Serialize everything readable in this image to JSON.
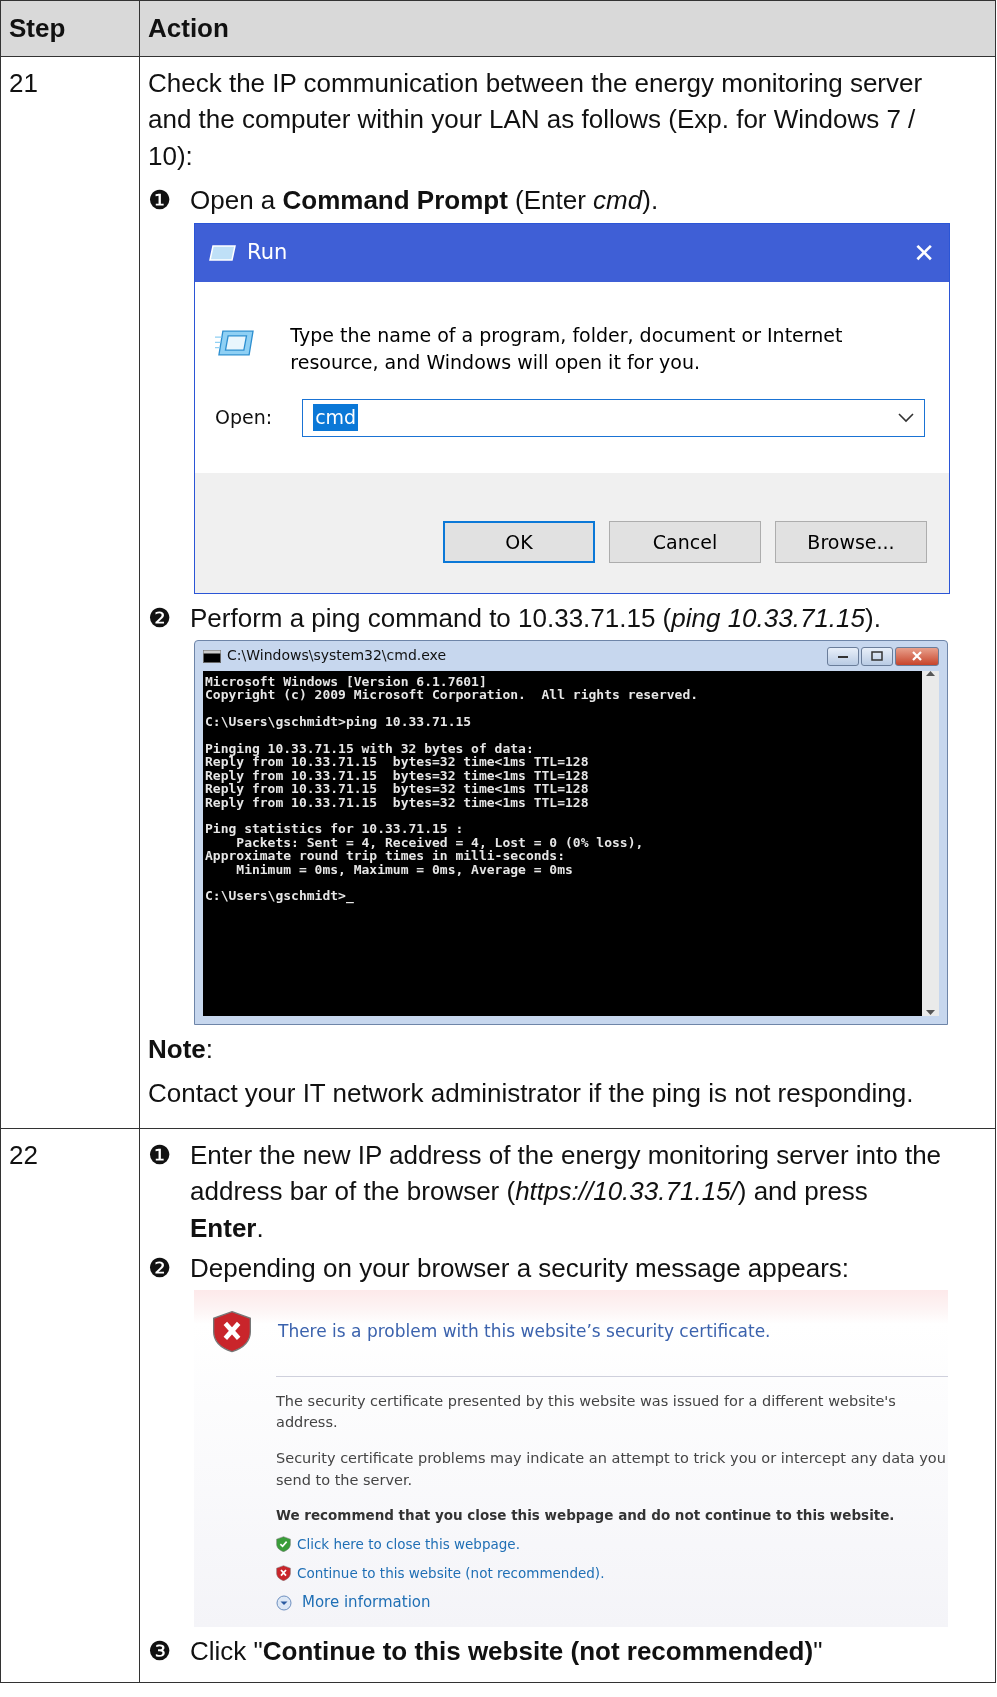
{
  "table": {
    "columns": [
      "Step",
      "Action"
    ],
    "rows": [
      {
        "step": "21",
        "blocks": [
          {
            "kind": "paragraph",
            "text": "Check the IP communication between the energy monitoring server and the computer within your LAN as follows (Exp. for Windows 7 / 10):"
          },
          {
            "kind": "item",
            "marker": "❶",
            "text": "Open a **Command Prompt** (Enter *cmd*)."
          },
          {
            "kind": "run_dialog",
            "title": "Run",
            "close": "✕",
            "message": "Type the name of a program, folder, document or Internet resource, and Windows will open it for you.",
            "field_label": "Open:",
            "value": "cmd",
            "buttons": [
              {
                "label": "OK",
                "selected": true
              },
              {
                "label": "Cancel",
                "selected": false
              },
              {
                "label": "Browse...",
                "selected": false
              }
            ]
          },
          {
            "kind": "item",
            "marker": "❷",
            "text": "Perform a ping command to 10.33.71.15 (*ping 10.33.71.15*)."
          },
          {
            "kind": "cmd_window",
            "title": "C:\\Windows\\system32\\cmd.exe",
            "groups": [
              [
                "Microsoft Windows [Version 6.1.7601]",
                "Copyright (c) 2009 Microsoft Corporation.  All rights reserved."
              ],
              [
                "C:\\Users\\gschmidt>ping 10.33.71.15"
              ],
              [
                "Pinging 10.33.71.15 with 32 bytes of data:",
                "Reply from 10.33.71.15  bytes=32 time<1ms TTL=128",
                "Reply from 10.33.71.15  bytes=32 time<1ms TTL=128",
                "Reply from 10.33.71.15  bytes=32 time<1ms TTL=128",
                "Reply from 10.33.71.15  bytes=32 time<1ms TTL=128"
              ],
              [
                "Ping statistics for 10.33.71.15 :",
                "    Packets: Sent = 4, Received = 4, Lost = 0 (0% loss),",
                "Approximate round trip times in milli-seconds:",
                "    Minimum = 0ms, Maximum = 0ms, Average = 0ms"
              ],
              [
                "C:\\Users\\gschmidt>_"
              ]
            ]
          },
          {
            "kind": "note_label",
            "text": "**Note**:"
          },
          {
            "kind": "paragraph",
            "text": "Contact your IT network administrator if the ping is not responding."
          }
        ]
      },
      {
        "step": "22",
        "blocks": [
          {
            "kind": "item",
            "marker": "❶",
            "text": "Enter the new IP address of the energy monitoring server into the address bar of the browser (*https://10.33.71.15/*) and press **Enter**."
          },
          {
            "kind": "item",
            "marker": "❷",
            "text": "Depending on your browser a security message appears:"
          },
          {
            "kind": "security_page",
            "title": "There is a problem with this website’s security certificate.",
            "paragraphs": [
              "The security certificate presented by this website was issued for a different website's address.",
              "Security certificate problems may indicate an attempt to trick you or intercept any data you send to the server."
            ],
            "warning": "We recommend that you close this webpage and do not continue to this website.",
            "links": [
              {
                "kind": "safe",
                "text": "Click here to close this webpage."
              },
              {
                "kind": "unsafe",
                "text": "Continue to this website (not recommended)."
              }
            ],
            "more": "More information"
          },
          {
            "kind": "item",
            "marker": "❸",
            "text": "Click \"**Continue to this website (not recommended)**\""
          }
        ]
      }
    ]
  }
}
